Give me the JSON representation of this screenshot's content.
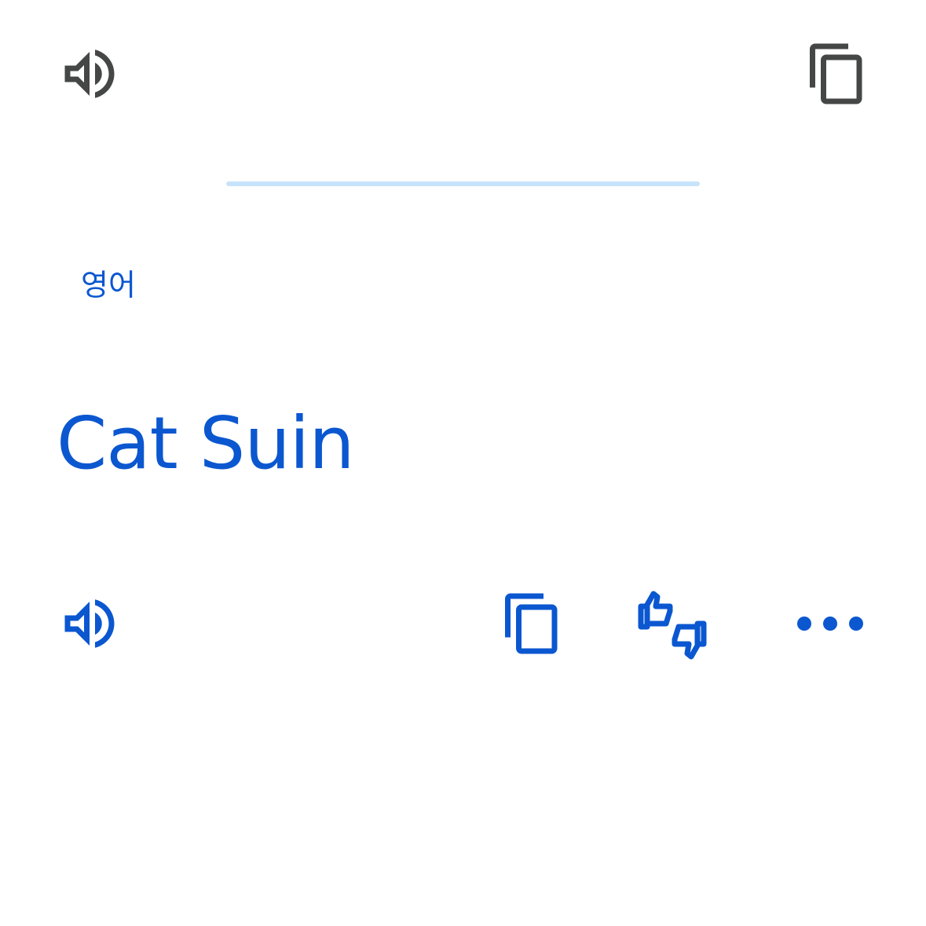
{
  "colors": {
    "icon_gray": "#444746",
    "accent_blue": "#0b57d0",
    "divider_light_blue": "#c7e3fb",
    "background": "#ffffff"
  },
  "source": {
    "speaker_icon": "volume-up-icon",
    "copy_icon": "content-copy-icon"
  },
  "result": {
    "language_label": "영어",
    "translation_text": "Cat Suin",
    "speaker_icon": "volume-up-icon",
    "copy_icon": "content-copy-icon",
    "rate_icon": "thumbs-up-down-icon",
    "more_icon": "more-horiz-icon"
  }
}
